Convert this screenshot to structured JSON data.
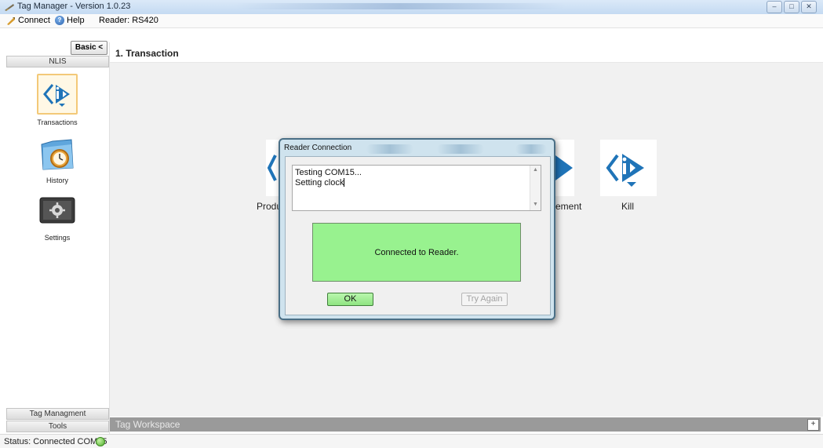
{
  "window": {
    "title": "Tag Manager - Version 1.0.23",
    "controls": [
      {
        "name": "minimize",
        "glyph": "–"
      },
      {
        "name": "maximize",
        "glyph": "□"
      },
      {
        "name": "close",
        "glyph": "✕"
      }
    ]
  },
  "menu": {
    "connect_label": "Connect",
    "help_label": "Help",
    "reader_label": "Reader: RS420"
  },
  "sidebar": {
    "mode_button": "Basic <",
    "section_title": "NLIS",
    "items": [
      {
        "label": "Transactions",
        "icon": "id-logo-icon",
        "selected": true
      },
      {
        "label": "History",
        "icon": "clock-folder-icon",
        "selected": false
      },
      {
        "label": "Settings",
        "icon": "gear-icon",
        "selected": false
      }
    ],
    "footer_sections": [
      "Tag Managment",
      "Tools"
    ]
  },
  "main": {
    "header": "1. Transaction",
    "tiles": [
      {
        "label": "Produ",
        "icon": "id-logo-icon"
      },
      {
        "label": "ement",
        "icon": "id-logo-icon"
      },
      {
        "label": "Kill",
        "icon": "id-logo-icon"
      }
    ],
    "workspace_label": "Tag Workspace",
    "workspace_toggle": "+"
  },
  "status": {
    "text": "Status: Connected COM15",
    "indicator_color": "#4fae2b"
  },
  "dialog": {
    "title": "Reader Connection",
    "log_lines": [
      "Testing COM15...",
      "Setting clock"
    ],
    "status_message": "Connected to Reader.",
    "status_color": "#98f28f",
    "ok_label": "OK",
    "retry_label": "Try Again"
  },
  "colors": {
    "brand_blue": "#1f74b8",
    "accent_dark": "#1b2a40"
  }
}
